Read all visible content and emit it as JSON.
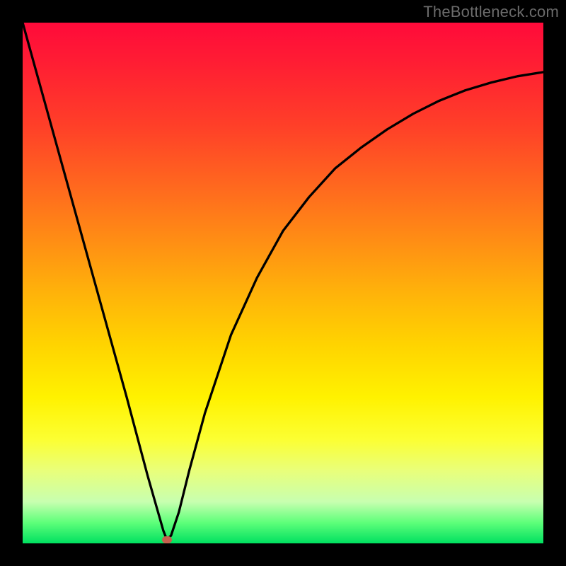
{
  "watermark": "TheBottleneck.com",
  "chart_data": {
    "type": "line",
    "title": "",
    "xlabel": "",
    "ylabel": "",
    "xlim": [
      0,
      100
    ],
    "ylim": [
      0,
      100
    ],
    "grid": false,
    "legend": false,
    "series": [
      {
        "name": "curve",
        "x": [
          0,
          5,
          10,
          15,
          20,
          24,
          26,
          27,
          27.7,
          28.5,
          30,
          32,
          35,
          40,
          45,
          50,
          55,
          60,
          65,
          70,
          75,
          80,
          85,
          90,
          95,
          100
        ],
        "values": [
          100,
          82,
          64,
          46,
          28,
          13,
          6,
          2.5,
          0.7,
          1.5,
          6,
          14,
          25,
          40,
          51,
          60,
          66.5,
          72,
          76,
          79.5,
          82.5,
          85,
          87,
          88.5,
          89.7,
          90.5
        ]
      }
    ],
    "minimum_point": {
      "x": 27.7,
      "y": 0.7
    },
    "colors": {
      "curve": "#000000",
      "marker": "#c7604e",
      "gradient_top": "#ff0a3a",
      "gradient_bottom": "#00e060"
    }
  }
}
